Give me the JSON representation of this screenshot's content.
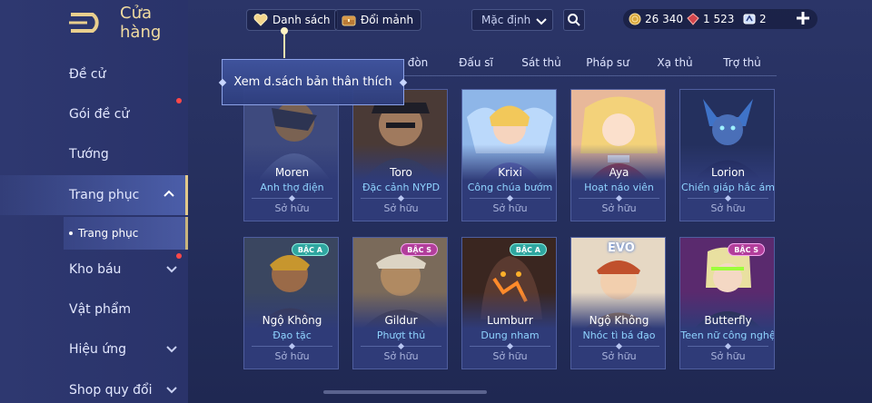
{
  "header": {
    "title": "Cửa hàng",
    "favorites_label": "Danh sách",
    "exchange_label": "Đổi mảnh",
    "sort_selected": "Mặc định"
  },
  "currency": {
    "gold": "26 340",
    "gems": "1 523",
    "vouchers": "2"
  },
  "tooltip": {
    "text": "Xem d.sách bản thân thích"
  },
  "sidebar": {
    "items": [
      {
        "label": "Đề cử"
      },
      {
        "label": "Gói đề cử"
      },
      {
        "label": "Tướng"
      },
      {
        "label": "Trang phục"
      },
      {
        "label": "Kho báu"
      },
      {
        "label": "Vật phẩm"
      },
      {
        "label": "Hiệu ứng"
      },
      {
        "label": "Shop quy đổi"
      }
    ],
    "sub_item": "Trang phục"
  },
  "tabs": [
    {
      "label": "đòn"
    },
    {
      "label": "Đấu sĩ"
    },
    {
      "label": "Sát thủ"
    },
    {
      "label": "Pháp sư"
    },
    {
      "label": "Xạ thủ"
    },
    {
      "label": "Trợ thủ"
    }
  ],
  "cards": [
    {
      "name": "Moren",
      "skin": "Anh thợ điện",
      "status": "Sở hữu",
      "badge": ""
    },
    {
      "name": "Toro",
      "skin": "Đặc cảnh NYPD",
      "status": "Sở hữu",
      "badge": ""
    },
    {
      "name": "Krixi",
      "skin": "Công chúa bướm",
      "status": "Sở hữu",
      "badge": ""
    },
    {
      "name": "Aya",
      "skin": "Hoạt náo viên",
      "status": "Sở hữu",
      "badge": ""
    },
    {
      "name": "Lorion",
      "skin": "Chiến giáp hắc ám",
      "status": "Sở hữu",
      "badge": ""
    },
    {
      "name": "Ngộ Không",
      "skin": "Đạo tặc",
      "status": "Sở hữu",
      "badge": "BẬC A"
    },
    {
      "name": "Gildur",
      "skin": "Phượt thủ",
      "status": "Sở hữu",
      "badge": "BẬC S"
    },
    {
      "name": "Lumburr",
      "skin": "Dung nham",
      "status": "Sở hữu",
      "badge": "BẬC A"
    },
    {
      "name": "Ngộ Không",
      "skin": "Nhóc tì bá đạo",
      "status": "Sở hữu",
      "badge": "EVO"
    },
    {
      "name": "Butterfly",
      "skin": "Teen nữ công nghệ",
      "status": "Sở hữu",
      "badge": "BẬC S"
    }
  ],
  "colors": {
    "accent_gold": "#e2c98a",
    "skin_text": "#8fd3ff",
    "notification": "#ff4848"
  }
}
